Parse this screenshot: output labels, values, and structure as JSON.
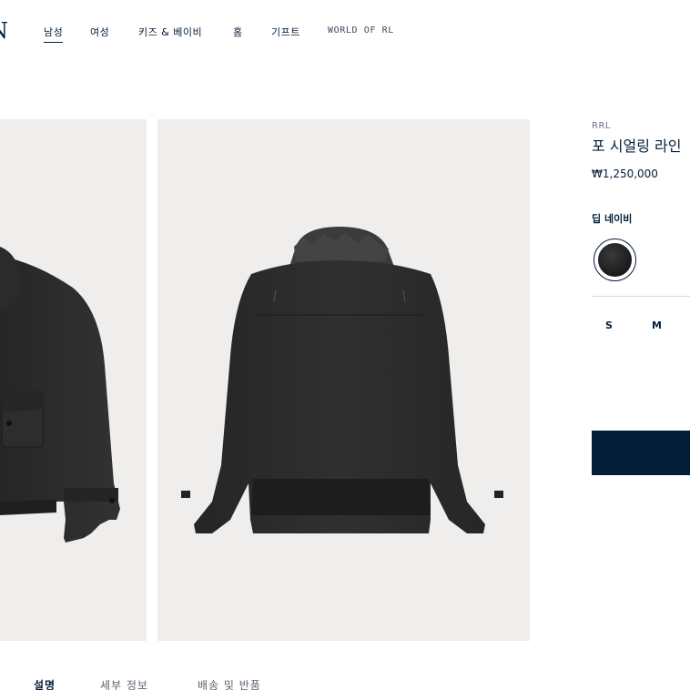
{
  "header": {
    "logo_text": "N",
    "nav": [
      {
        "label": "남성",
        "active": true
      },
      {
        "label": "여성"
      },
      {
        "label": "키즈 & 베이비"
      },
      {
        "label": "홈"
      },
      {
        "label": "기프트"
      },
      {
        "label": "WORLD OF RL"
      }
    ]
  },
  "product": {
    "brand": "RRL",
    "title": "포 시얼링 라인",
    "price": "₩1,250,000",
    "color_name": "딥 네이비",
    "swatch_color": "#1f1f1f",
    "sizes": [
      "S",
      "M"
    ],
    "add_button_color": "#041e3a"
  },
  "gallery": {
    "background": "#efeeec",
    "images": [
      "jacket-front-view",
      "jacket-back-view"
    ]
  },
  "tabs": [
    "설명",
    "세부 정보",
    "배송 및 반품"
  ],
  "colors": {
    "brand_navy": "#041e3a"
  }
}
